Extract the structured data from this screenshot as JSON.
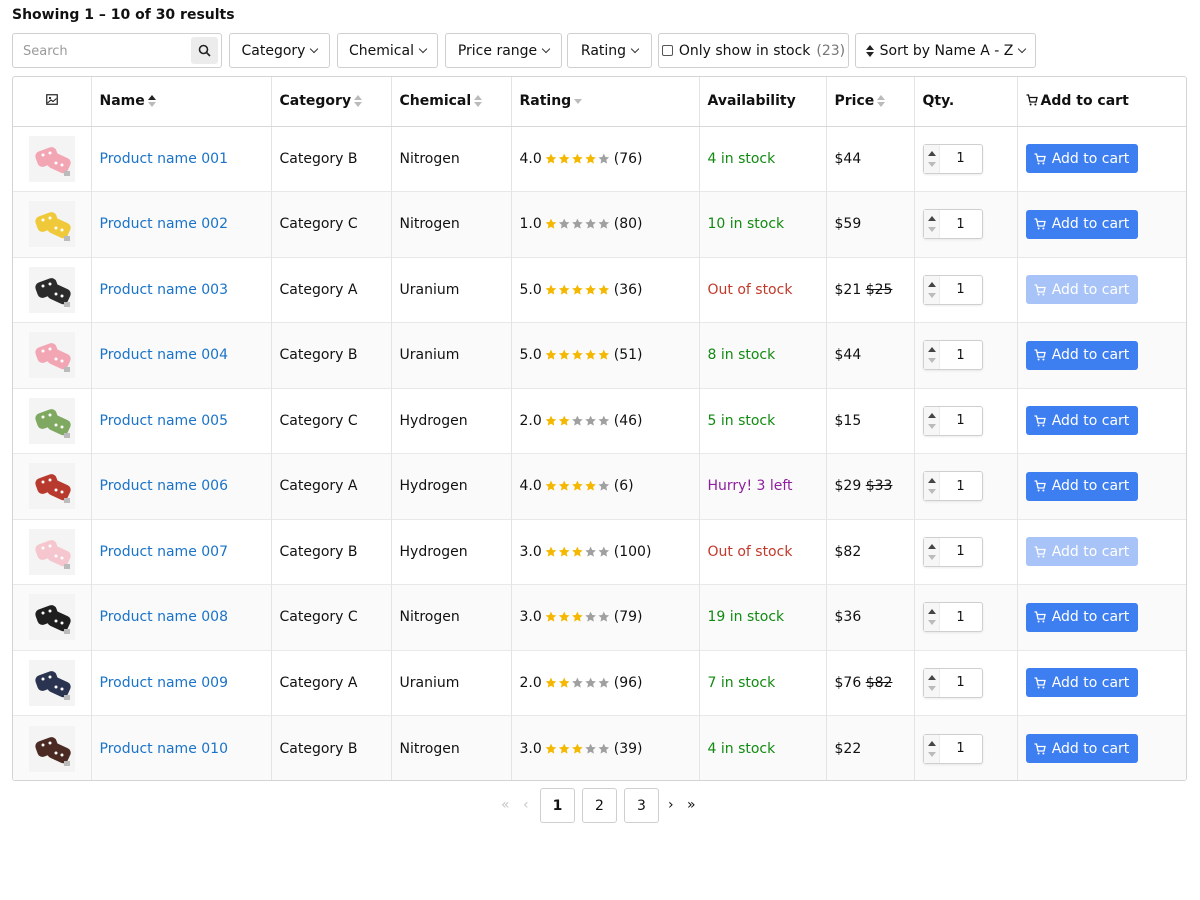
{
  "results_text": "Showing 1 – 10 of 30 results",
  "search": {
    "placeholder": "Search"
  },
  "filters": {
    "category": "Category",
    "chemical": "Chemical",
    "price_range": "Price range",
    "rating": "Rating",
    "in_stock_label": "Only show in stock",
    "in_stock_count": "(23)",
    "sort": "Sort by Name A - Z"
  },
  "columns": {
    "name": "Name",
    "category": "Category",
    "chemical": "Chemical",
    "rating": "Rating",
    "availability": "Availability",
    "price": "Price",
    "qty": "Qty.",
    "add_to_cart": "Add to cart"
  },
  "products": [
    {
      "name": "Product name 001",
      "category": "Category B",
      "chemical": "Nitrogen",
      "rating": "4.0",
      "stars": 4,
      "reviews": "(76)",
      "availability": "4 in stock",
      "status": "in",
      "price": "$44",
      "old_price": "",
      "qty": "1",
      "button": "Add to cart",
      "enabled": true,
      "thumb_color": "#f2a6b4"
    },
    {
      "name": "Product name 002",
      "category": "Category C",
      "chemical": "Nitrogen",
      "rating": "1.0",
      "stars": 1,
      "reviews": "(80)",
      "availability": "10 in stock",
      "status": "in",
      "price": "$59",
      "old_price": "",
      "qty": "1",
      "button": "Add to cart",
      "enabled": true,
      "thumb_color": "#f0c93a"
    },
    {
      "name": "Product name 003",
      "category": "Category A",
      "chemical": "Uranium",
      "rating": "5.0",
      "stars": 5,
      "reviews": "(36)",
      "availability": "Out of stock",
      "status": "out",
      "price": "$21",
      "old_price": "$25",
      "qty": "1",
      "button": "Add to cart",
      "enabled": false,
      "thumb_color": "#2b2b2b"
    },
    {
      "name": "Product name 004",
      "category": "Category B",
      "chemical": "Uranium",
      "rating": "5.0",
      "stars": 5,
      "reviews": "(51)",
      "availability": "8 in stock",
      "status": "in",
      "price": "$44",
      "old_price": "",
      "qty": "1",
      "button": "Add to cart",
      "enabled": true,
      "thumb_color": "#f2a6b4"
    },
    {
      "name": "Product name 005",
      "category": "Category C",
      "chemical": "Hydrogen",
      "rating": "2.0",
      "stars": 2,
      "reviews": "(46)",
      "availability": "5 in stock",
      "status": "in",
      "price": "$15",
      "old_price": "",
      "qty": "1",
      "button": "Add to cart",
      "enabled": true,
      "thumb_color": "#7fa860"
    },
    {
      "name": "Product name 006",
      "category": "Category A",
      "chemical": "Hydrogen",
      "rating": "4.0",
      "stars": 4,
      "reviews": "(6)",
      "availability": "Hurry! 3 left",
      "status": "hurry",
      "price": "$29",
      "old_price": "$33",
      "qty": "1",
      "button": "Add to cart",
      "enabled": true,
      "thumb_color": "#b83a2e"
    },
    {
      "name": "Product name 007",
      "category": "Category B",
      "chemical": "Hydrogen",
      "rating": "3.0",
      "stars": 3,
      "reviews": "(100)",
      "availability": "Out of stock",
      "status": "out",
      "price": "$82",
      "old_price": "",
      "qty": "1",
      "button": "Add to cart",
      "enabled": false,
      "thumb_color": "#f5c6cd"
    },
    {
      "name": "Product name 008",
      "category": "Category C",
      "chemical": "Nitrogen",
      "rating": "3.0",
      "stars": 3,
      "reviews": "(79)",
      "availability": "19 in stock",
      "status": "in",
      "price": "$36",
      "old_price": "",
      "qty": "1",
      "button": "Add to cart",
      "enabled": true,
      "thumb_color": "#1f1f1f"
    },
    {
      "name": "Product name 009",
      "category": "Category A",
      "chemical": "Uranium",
      "rating": "2.0",
      "stars": 2,
      "reviews": "(96)",
      "availability": "7 in stock",
      "status": "in",
      "price": "$76",
      "old_price": "$82",
      "qty": "1",
      "button": "Add to cart",
      "enabled": true,
      "thumb_color": "#2a3450"
    },
    {
      "name": "Product name 010",
      "category": "Category B",
      "chemical": "Nitrogen",
      "rating": "3.0",
      "stars": 3,
      "reviews": "(39)",
      "availability": "4 in stock",
      "status": "in",
      "price": "$22",
      "old_price": "",
      "qty": "1",
      "button": "Add to cart",
      "enabled": true,
      "thumb_color": "#4a2a22"
    }
  ],
  "pagination": {
    "pages": [
      "1",
      "2",
      "3"
    ],
    "current": "1",
    "first": "«",
    "prev": "‹",
    "next": "›",
    "last": "»"
  },
  "colors": {
    "accent": "#3d7ef0",
    "link": "#1a73c8",
    "in_stock": "#128a12",
    "out_of_stock": "#c0392b",
    "hurry": "#8e1f9e",
    "star": "#f5b800"
  }
}
